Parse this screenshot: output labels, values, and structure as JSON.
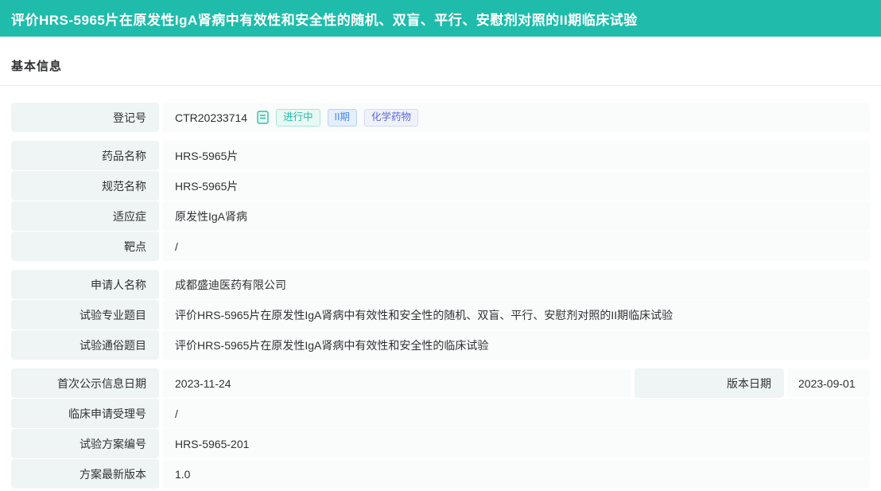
{
  "page": {
    "title": "评价HRS-5965片在原发性IgA肾病中有效性和安全性的随机、双盲、平行、安慰剂对照的II期临床试验",
    "section_title": "基本信息"
  },
  "colors": {
    "header_bg": "#1fbcab",
    "label_cell_bg": "#eff5f4",
    "value_cell_bg": "#fafbfb",
    "status_green": "#1fbca4",
    "phase_blue": "#4d8be8",
    "drug_type_indigo": "#5a68d8"
  },
  "registration": {
    "label": "登记号",
    "value": "CTR20233714",
    "icon": "document-icon",
    "badges": [
      {
        "label": "进行中",
        "type": "status"
      },
      {
        "label": "II期",
        "type": "phase"
      },
      {
        "label": "化学药物",
        "type": "drug-type"
      }
    ]
  },
  "groups": [
    {
      "rows": [
        {
          "label": "药品名称",
          "value": "HRS-5965片"
        },
        {
          "label": "规范名称",
          "value": "HRS-5965片"
        },
        {
          "label": "适应症",
          "value": "原发性IgA肾病"
        },
        {
          "label": "靶点",
          "value": "/"
        }
      ]
    },
    {
      "rows": [
        {
          "label": "申请人名称",
          "value": "成都盛迪医药有限公司"
        },
        {
          "label": "试验专业题目",
          "value": "评价HRS-5965片在原发性IgA肾病中有效性和安全性的随机、双盲、平行、安慰剂对照的II期临床试验"
        },
        {
          "label": "试验通俗题目",
          "value": "评价HRS-5965片在原发性IgA肾病中有效性和安全性的临床试验"
        }
      ]
    },
    {
      "rows": [
        {
          "label": "首次公示信息日期",
          "value": "2023-11-24",
          "label2": "版本日期",
          "value2": "2023-09-01"
        },
        {
          "label": "临床申请受理号",
          "value": "/"
        },
        {
          "label": "试验方案编号",
          "value": "HRS-5965-201"
        },
        {
          "label": "方案最新版本",
          "value": "1.0"
        }
      ]
    }
  ]
}
